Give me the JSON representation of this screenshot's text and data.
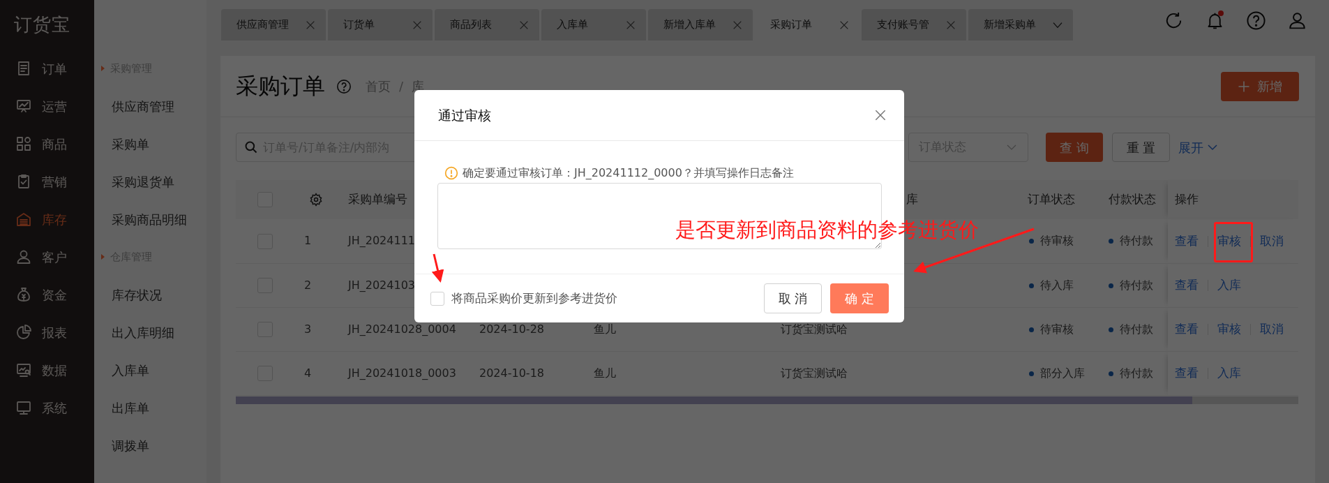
{
  "app": {
    "logo": "订货宝"
  },
  "nav": [
    {
      "label": "订单",
      "kind": "doc",
      "selected": false
    },
    {
      "label": "运营",
      "kind": "board",
      "selected": false
    },
    {
      "label": "商品",
      "kind": "grid",
      "selected": false
    },
    {
      "label": "营销",
      "kind": "clipboard",
      "selected": false
    },
    {
      "label": "库存",
      "kind": "warehouse",
      "selected": true
    },
    {
      "label": "客户",
      "kind": "user",
      "selected": false
    },
    {
      "label": "资金",
      "kind": "moneybag",
      "selected": false
    },
    {
      "label": "报表",
      "kind": "pie",
      "selected": false
    },
    {
      "label": "数据",
      "kind": "monitor-search",
      "selected": false
    },
    {
      "label": "系统",
      "kind": "monitor",
      "selected": false
    }
  ],
  "subnav": [
    {
      "title": "采购管理",
      "items": [
        "供应商管理",
        "采购单",
        "采购退货单",
        "采购商品明细"
      ]
    },
    {
      "title": "仓库管理",
      "items": [
        "库存状况",
        "出入库明细",
        "入库单",
        "出库单",
        "调拨单"
      ]
    }
  ],
  "tabs": [
    {
      "label": "供应商管理",
      "kind": "close",
      "selected": false
    },
    {
      "label": "订货单",
      "kind": "close",
      "selected": false
    },
    {
      "label": "商品列表",
      "kind": "close",
      "selected": false
    },
    {
      "label": "入库单",
      "kind": "close",
      "selected": false
    },
    {
      "label": "新增入库单",
      "kind": "close",
      "selected": false
    },
    {
      "label": "采购订单",
      "kind": "close",
      "selected": true
    },
    {
      "label": "支付账号管",
      "kind": "close",
      "selected": false
    },
    {
      "label": "新增采购单",
      "kind": "dropdown",
      "selected": false
    }
  ],
  "toolbar": [
    {
      "kind": "refresh"
    },
    {
      "kind": "bell",
      "unread": true
    },
    {
      "kind": "help"
    },
    {
      "kind": "user"
    }
  ],
  "page": {
    "title": "采购订单",
    "breadcrumb": [
      "首页",
      "库"
    ],
    "breadcrumb_separator": "/",
    "add_button": "新增"
  },
  "filters": {
    "search_placeholder": "订单号/订单备注/内部沟",
    "status_placeholder": "订单状态",
    "query_button": "查 询",
    "reset_button": "重 置",
    "expand_link": "展开"
  },
  "table": {
    "header": {
      "checked": false,
      "number": "采购单编号",
      "warehouse": "库",
      "order_status": "订单状态",
      "payment_status": "付款状态",
      "actions": "操作"
    },
    "rows": [
      {
        "checked": false,
        "index": "1",
        "number": "JH_2024111",
        "order_status": "待审核",
        "payment_status": "待付款",
        "actions": [
          "查看",
          "审核",
          "取消"
        ]
      },
      {
        "checked": false,
        "index": "2",
        "number": "JH_2024103",
        "order_status": "待入库",
        "payment_status": "待付款",
        "actions": [
          "查看",
          "入库"
        ]
      },
      {
        "checked": false,
        "index": "3",
        "number": "JH_20241028_0004",
        "date": "2024-10-28",
        "supplier": "鱼儿",
        "warehouse": "订货宝测试哈",
        "order_status": "待审核",
        "payment_status": "待付款",
        "actions": [
          "查看",
          "审核",
          "取消"
        ]
      },
      {
        "checked": false,
        "index": "4",
        "number": "JH_20241018_0003",
        "date": "2024-10-18",
        "supplier": "鱼儿",
        "warehouse": "订货宝测试哈",
        "order_status": "部分入库",
        "payment_status": "待付款",
        "actions": [
          "查看",
          "入库"
        ]
      }
    ],
    "scroll": {
      "level": 0.9
    }
  },
  "modal": {
    "title": "通过审核",
    "message": "确定要通过审核订单：JH_20241112_0000？并填写操作日志备注",
    "checkbox": {
      "label": "将商品采购价更新到参考进货价",
      "checked": false
    },
    "buttons": [
      {
        "label": "取 消",
        "kind": "default"
      },
      {
        "label": "确 定",
        "kind": "primary"
      }
    ]
  },
  "annotation": {
    "text": "是否更新到商品资料的参考进货价"
  }
}
